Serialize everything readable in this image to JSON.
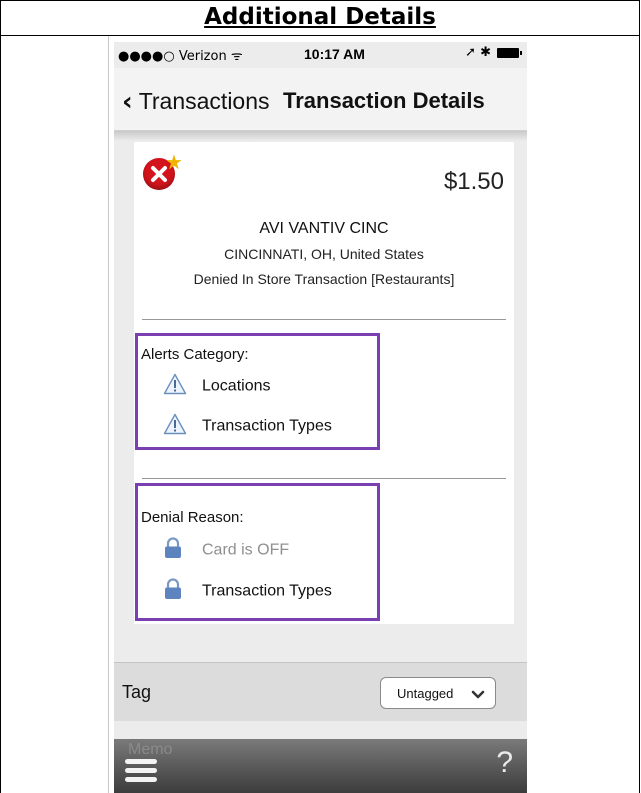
{
  "document": {
    "title": "Additional Details"
  },
  "status_bar": {
    "carrier": "●●●●○ Verizon ᯤ",
    "time": "10:17 AM",
    "indicators": "➚ ✱"
  },
  "nav": {
    "back_label": "Transactions",
    "title": "Transaction Details"
  },
  "transaction": {
    "status_icon": "denied-x-icon",
    "amount": "$1.50",
    "merchant": "AVI VANTIV CINC",
    "location": "CINCINNATI, OH, United States",
    "type": "Denied In Store Transaction [Restaurants]"
  },
  "alerts": {
    "heading": "Alerts Category:",
    "items": [
      {
        "label": "Locations",
        "icon": "warning-triangle-icon"
      },
      {
        "label": "Transaction Types",
        "icon": "warning-triangle-icon"
      }
    ]
  },
  "denial": {
    "heading": "Denial Reason:",
    "items": [
      {
        "label": "Card is OFF",
        "icon": "lock-icon",
        "muted": true
      },
      {
        "label": "Transaction Types",
        "icon": "lock-icon",
        "muted": false
      }
    ]
  },
  "tag": {
    "label": "Tag",
    "value": "Untagged"
  },
  "memo": {
    "label": "Memo"
  },
  "toolbar": {
    "help_symbol": "?"
  },
  "colors": {
    "highlight": "#7a3fb0",
    "denied": "#d4141c",
    "star": "#f0b400"
  }
}
